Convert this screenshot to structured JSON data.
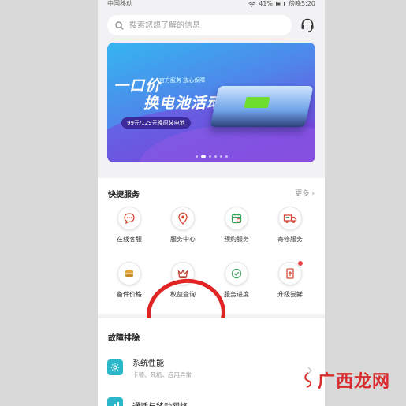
{
  "statusbar": {
    "carrier": "中国移动",
    "battery": "41%",
    "time": "傍晚5:20"
  },
  "search": {
    "placeholder": "搜索您想了解的信息"
  },
  "banner": {
    "headline_1": "一口价",
    "headline_2": "换电池活动",
    "subline": "官方服务 放心保障",
    "price_pill": "99元/129元换原装电池",
    "slides": 6,
    "active_slide": 2
  },
  "quick": {
    "title": "快捷服务",
    "more": "更多",
    "items": [
      {
        "label": "在线客服",
        "icon": "chat-icon"
      },
      {
        "label": "服务中心",
        "icon": "location-pin-icon"
      },
      {
        "label": "预约服务",
        "icon": "calendar-icon"
      },
      {
        "label": "寄修服务",
        "icon": "truck-icon"
      },
      {
        "label": "备件价格",
        "icon": "coins-icon"
      },
      {
        "label": "权益查询",
        "icon": "crown-icon"
      },
      {
        "label": "服务进度",
        "icon": "progress-icon"
      },
      {
        "label": "升级尝鲜",
        "icon": "phone-upgrade-icon",
        "badge": true
      }
    ]
  },
  "fault": {
    "title": "故障排除",
    "items": [
      {
        "title": "系统性能",
        "subtitle": "卡顿、死机、应用异常",
        "icon": "gear-icon"
      },
      {
        "title": "通话与移动网络",
        "subtitle": "",
        "icon": "network-icon"
      }
    ]
  },
  "watermark": {
    "text": "广西龙网"
  },
  "colors": {
    "accent": "#d94a3a",
    "teal": "#2ab7c9",
    "highlight": "#e02424"
  }
}
